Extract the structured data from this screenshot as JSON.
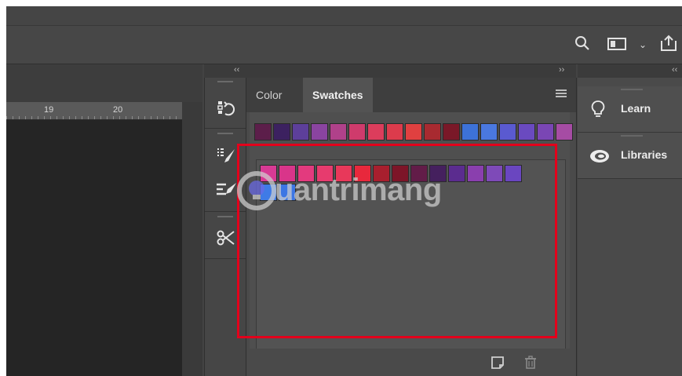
{
  "toolbar": {
    "search_icon": "search-icon",
    "screen_mode_icon": "screen-mode-icon",
    "screen_mode_chevron": "⌄",
    "share_icon": "share-icon"
  },
  "collapse": {
    "left_arrows": "‹‹",
    "middle_arrows": "››",
    "right_arrows": "‹‹"
  },
  "ruler": {
    "labels": [
      "19",
      "20"
    ]
  },
  "panel": {
    "tabs": [
      {
        "label": "Color",
        "active": false
      },
      {
        "label": "Swatches",
        "active": true
      }
    ],
    "menu_icon": "panel-menu-icon",
    "recent_swatches": [
      "#5c1e4a",
      "#3c2160",
      "#5d3f9a",
      "#8a44a0",
      "#b0418a",
      "#cf3b6c",
      "#dc3d5c",
      "#dc3b4c",
      "#e04040",
      "#a82a30",
      "#7a1828",
      "#3d72d8",
      "#4a78e0",
      "#5a5ad0",
      "#6a4ac0",
      "#7a46b4",
      "#a64ca4"
    ],
    "swatches_row1": [
      "#d83a94",
      "#d9358a",
      "#e33a7e",
      "#e73b6e",
      "#e8385a",
      "#e8283c",
      "#a81f2e",
      "#7d1528",
      "#621c48",
      "#45205e",
      "#5b2c8f",
      "#8a3fae",
      "#7e4ab8",
      "#6a46c0"
    ],
    "swatches_row2": [
      "#3f7be6",
      "#3c76e4"
    ],
    "footer": {
      "new_swatch_icon": "new-swatch-icon",
      "delete_icon": "trash-icon"
    }
  },
  "right_panel": {
    "items": [
      {
        "label": "Learn",
        "icon": "lightbulb-icon"
      },
      {
        "label": "Libraries",
        "icon": "libraries-icon"
      }
    ]
  },
  "watermark": {
    "text": "uantrimang"
  },
  "highlight_color": "#e3001b"
}
